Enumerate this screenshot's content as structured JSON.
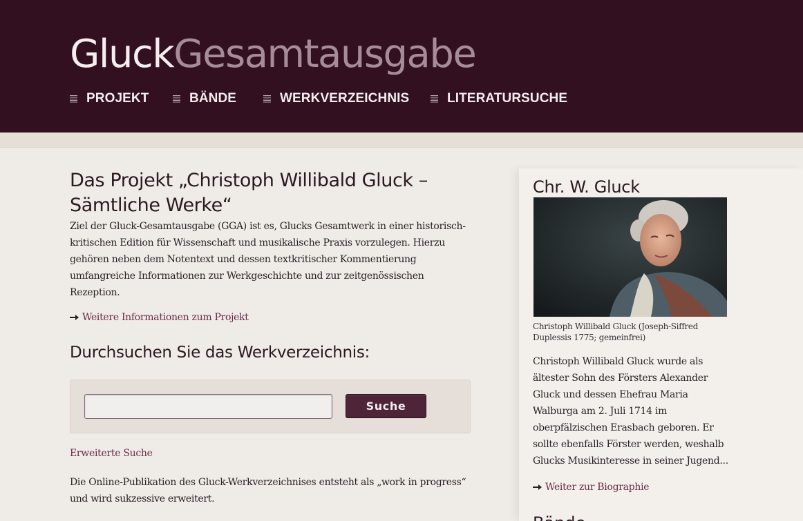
{
  "logo": {
    "part1": "Gluck",
    "part2": "Gesamtausgabe"
  },
  "nav": {
    "items": [
      {
        "label": "PROJEKT"
      },
      {
        "label": "BÄNDE"
      },
      {
        "label": "WERKVERZEICHNIS"
      },
      {
        "label": "LITERATURSUCHE"
      }
    ]
  },
  "main": {
    "heading_line1": "Das Projekt „Christoph Willibald Gluck –",
    "heading_line2": "Sämtliche Werke“",
    "intro_lines": [
      "Ziel der Gluck-Gesamtausgabe (GGA) ist es, Glucks Gesamtwerk in einer historisch-",
      "kritischen Edition für Wissenschaft und musikalische Praxis vorzulegen. Hierzu",
      "gehören neben dem Notentext und dessen textkritischer Kommentierung",
      "umfangreiche Informationen zur Werkgeschichte und zur zeitgenössischen",
      "Rezeption."
    ],
    "more_info_link": "Weitere Informationen zum Projekt",
    "search_heading": "Durchsuchen Sie das Werkverzeichnis:",
    "search": {
      "value": "",
      "placeholder": "",
      "button_label": "Suche"
    },
    "advanced_search_link": "Erweiterte Suche",
    "note_lines": [
      "Die Online-Publikation des Gluck-Werkverzeichnises entsteht als „work in progress“",
      "und wird sukzessive erweitert."
    ]
  },
  "sidebar": {
    "title": "Chr. W. Gluck",
    "caption_lines": [
      "Christoph Willibald Gluck (Joseph-Siffred",
      "Duplessis 1775; gemeinfrei)"
    ],
    "bio_lines": [
      "Christoph Willibald Gluck wurde als",
      "ältester Sohn des Försters Alexander",
      "Gluck und dessen Ehefrau Maria",
      "Walburga am 2. Juli 1714 im",
      "oberpfälzischen Erasbach geboren. Er",
      "sollte ebenfalls Förster werden, weshalb",
      "Glucks Musikinteresse in seiner Jugend..."
    ],
    "bio_link": "Weiter zur Biographie",
    "next_heading": "Bände"
  },
  "colors": {
    "header_bg": "#32101f",
    "accent": "#6b2a48",
    "button_bg": "#4e2438"
  },
  "icons": {
    "nav": "menu-lines-icon",
    "link": "arrow-right-icon"
  }
}
